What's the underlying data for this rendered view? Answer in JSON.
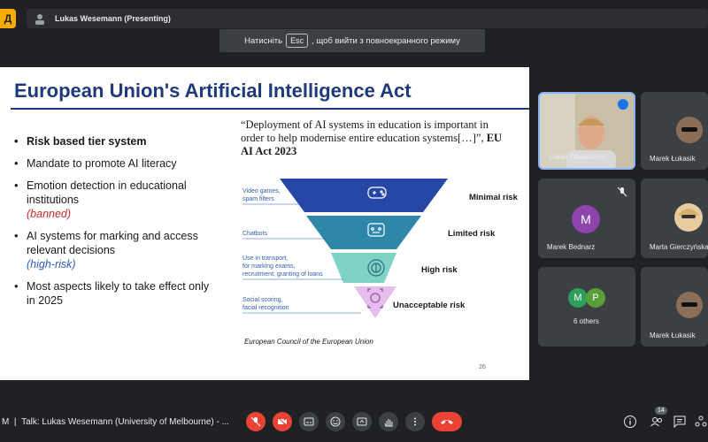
{
  "app": {
    "logo_letter": "Д"
  },
  "presenter": {
    "label": "Lukas Wesemann (Presenting)"
  },
  "esc_banner": {
    "before": "Натисніть",
    "key": "Esc",
    "after": ", щоб вийти з повноекранного режиму"
  },
  "slide": {
    "title": "European Union's Artificial Intelligence Act",
    "bullets": [
      {
        "text": "Risk based tier system"
      },
      {
        "text": "Mandate to promote AI literacy"
      },
      {
        "text": "Emotion detection in educational institutions",
        "note": "(banned)"
      },
      {
        "text": "AI systems for marking and access relevant decisions",
        "note": "(high-risk)"
      },
      {
        "text": "Most aspects likely to take effect only in 2025"
      }
    ],
    "quote": "“Deployment of AI systems in education is important in order to help modernise entire education systems[…]”,",
    "quote_source": "EU AI Act 2023",
    "tiers": [
      {
        "examples": [
          "Video games,",
          "spam filters"
        ],
        "risk": "Minimal risk",
        "color": "#2647a6"
      },
      {
        "examples": [
          "Chatbots"
        ],
        "risk": "Limited risk",
        "color": "#2e86a8"
      },
      {
        "examples": [
          "Use in transport,",
          "for marking exams,",
          "recruitment, granting of loans"
        ],
        "risk": "High risk",
        "color": "#7fd3c5"
      },
      {
        "examples": [
          "Social scoring,",
          "facial recognition"
        ],
        "risk": "Unacceptable risk",
        "color": "#e7bdf0"
      }
    ],
    "credit": "European Council of the European Union",
    "page_number": "26"
  },
  "participants": [
    {
      "name": "Lukas Wesemann"
    },
    {
      "name": "Marek Łukasik"
    },
    {
      "name": "Marek Bednarz",
      "initial": "M",
      "color": "#8e44ad"
    },
    {
      "name": "Marta Gierczyńska"
    },
    {
      "name": "6 others",
      "initials": [
        "M",
        "P"
      ],
      "colors": [
        "#2e9e5b",
        "#5a9e3a"
      ]
    },
    {
      "name": "Marek Łukasik"
    }
  ],
  "bottom": {
    "title_prefix": "M",
    "meeting_title": "Talk: Lukas Wesemann (University of Melbourne) - ...",
    "participant_count": "14"
  }
}
